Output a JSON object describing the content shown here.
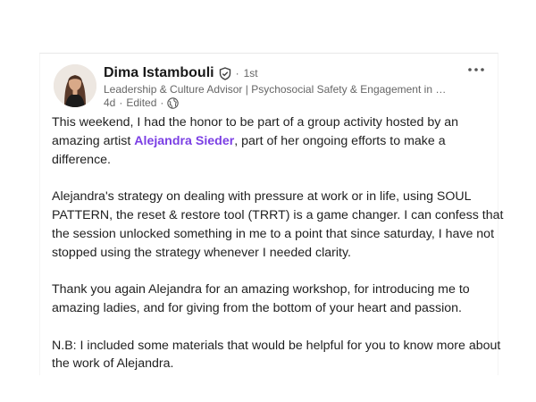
{
  "post": {
    "author": {
      "name": "Dima Istambouli",
      "degree": "1st",
      "degree_separator": "·",
      "headline": "Leadership & Culture Advisor | Psychosocial Safety & Engagement in Co...",
      "avatar": "avatar-photo"
    },
    "meta": {
      "age": "4d",
      "edited": "Edited",
      "separator1": "·",
      "separator2": "·",
      "visibility_icon": "globe-icon"
    },
    "menu_icon": "more-horizontal-icon",
    "paragraph1": {
      "before": "This weekend, I had the honor to be part of a group activity hosted by an amazing artist ",
      "mention": "Alejandra Sieder",
      "after": ", part of her ongoing efforts to make a difference."
    },
    "paragraph2": "Alejandra's strategy on dealing with pressure at work or in life, using SOUL PATTERN, the reset & restore tool (TRRT) is a game changer. I can confess that the session unlocked something in me to a point that since saturday, I have not stopped using the strategy whenever I needed clarity.",
    "paragraph3": "Thank you again Alejandra for an amazing workshop, for introducing me to amazing ladies, and for giving from the bottom of your heart and passion.",
    "paragraph4": "N.B: I included some materials that would be helpful for you to know more about the work of Alejandra."
  },
  "colors": {
    "mention": "#7b3fe4",
    "secondary_text": "#666666",
    "primary_text": "#1f1f1f"
  }
}
